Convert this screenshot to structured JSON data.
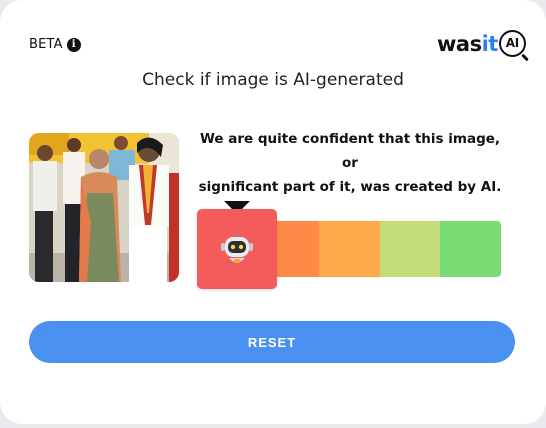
{
  "header": {
    "beta_label": "BETA",
    "logo_prefix": "was",
    "logo_highlight": "it",
    "logo_badge": "AI"
  },
  "title": "Check if image is AI-generated",
  "result": {
    "verdict_line1": "We are quite confident that this image, or",
    "verdict_line2": "significant part of it, was created by AI.",
    "meter_level": "1 of 5 (AI end)",
    "meter_colors": [
      "#f45b5b",
      "#ff8a47",
      "#ffab4c",
      "#c3de78",
      "#79dc72"
    ],
    "marker_icon": "robot-icon",
    "marker_color": "#f45b5b"
  },
  "actions": {
    "reset_label": "RESET",
    "reset_color": "#4a90f0"
  },
  "colors": {
    "logo_accent": "#2f7fe8"
  }
}
